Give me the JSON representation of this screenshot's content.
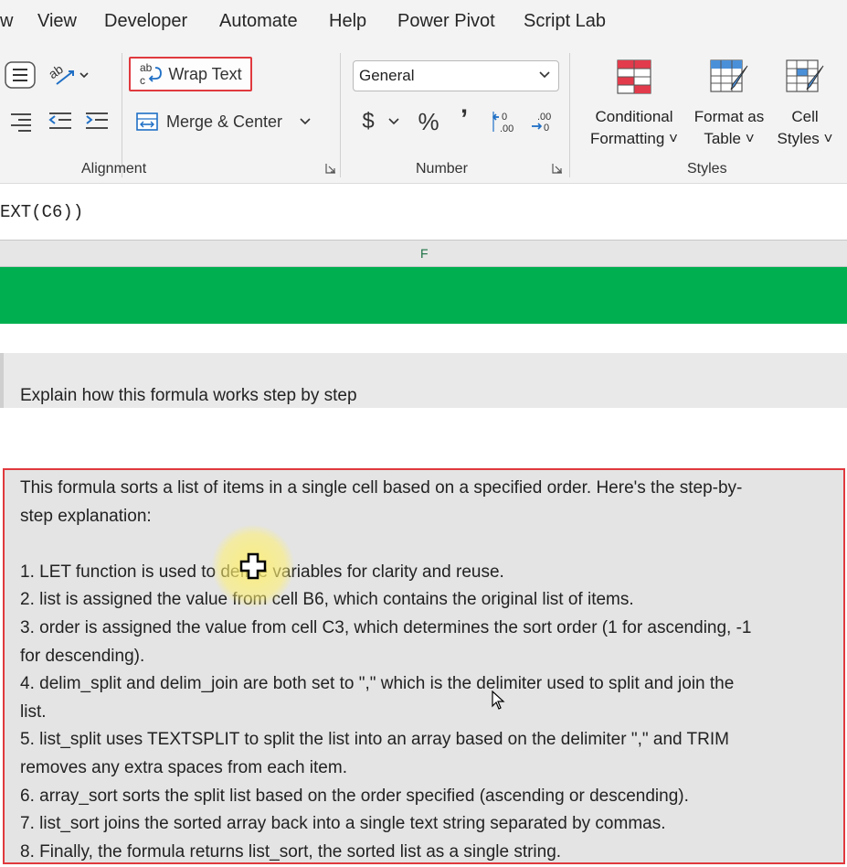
{
  "menu": {
    "tabs": [
      "w",
      "View",
      "Developer",
      "Automate",
      "Help",
      "Power Pivot",
      "Script Lab"
    ]
  },
  "ribbon": {
    "alignment": {
      "wrap_text_label": "Wrap Text",
      "merge_center_label": "Merge & Center",
      "group_label": "Alignment"
    },
    "number": {
      "format_value": "General",
      "currency_symbol": "$",
      "percent_symbol": "%",
      "comma_symbol": "’",
      "group_label": "Number"
    },
    "styles": {
      "conditional_formatting": [
        "Conditional",
        "Formatting ˅"
      ],
      "format_as_table": [
        "Format as",
        "Table ˅"
      ],
      "cell_styles": [
        "Cell",
        "Styles ˅"
      ],
      "group_label": "Styles"
    }
  },
  "formula_bar": {
    "text": "EXT(C6))"
  },
  "sheet": {
    "column_header": "F",
    "prompt_text": "Explain how this formula works step by step",
    "answer_lines": [
      "This formula sorts a list of items in a single cell based on a specified order. Here's the step-by-",
      "step explanation:",
      "",
      "1. LET function is used to define variables for clarity and reuse.",
      "2. list is assigned the value from cell B6, which contains the original list of items.",
      "3. order is assigned the value from cell C3, which determines the sort order (1 for ascending, -1",
      "for descending).",
      "4. delim_split and delim_join are both set to \",\" which is the delimiter used to split and join the",
      "list.",
      "5. list_split uses TEXTSPLIT to split the list into an array based on the delimiter \",\" and TRIM",
      "removes any extra spaces from each item.",
      "6. array_sort sorts the split list based on the order specified (ascending or descending).",
      "7. list_sort joins the sorted array back into a single text string separated by commas.",
      "8. Finally, the formula returns list_sort, the sorted list as a single string."
    ]
  },
  "colors": {
    "highlight_border": "#e0393e",
    "green_band": "#00b050",
    "ribbon_bg": "#f3f3f3"
  }
}
